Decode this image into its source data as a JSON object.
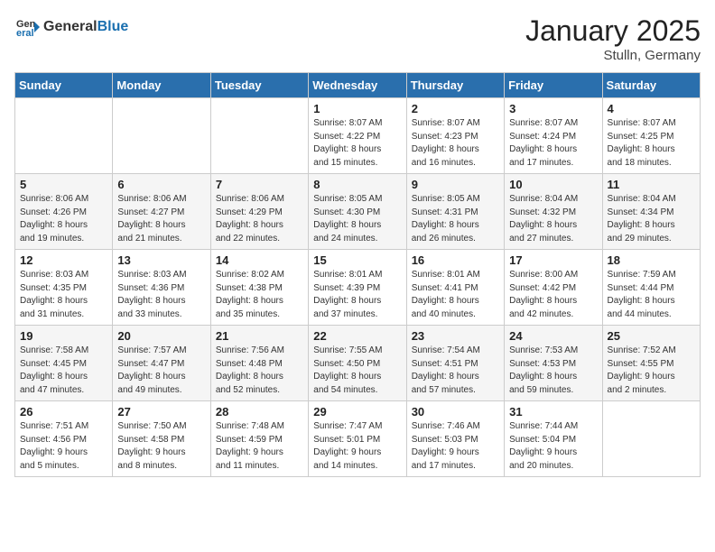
{
  "logo": {
    "general": "General",
    "blue": "Blue"
  },
  "title": "January 2025",
  "location": "Stulln, Germany",
  "days_header": [
    "Sunday",
    "Monday",
    "Tuesday",
    "Wednesday",
    "Thursday",
    "Friday",
    "Saturday"
  ],
  "weeks": [
    [
      {
        "day": "",
        "info": ""
      },
      {
        "day": "",
        "info": ""
      },
      {
        "day": "",
        "info": ""
      },
      {
        "day": "1",
        "info": "Sunrise: 8:07 AM\nSunset: 4:22 PM\nDaylight: 8 hours\nand 15 minutes."
      },
      {
        "day": "2",
        "info": "Sunrise: 8:07 AM\nSunset: 4:23 PM\nDaylight: 8 hours\nand 16 minutes."
      },
      {
        "day": "3",
        "info": "Sunrise: 8:07 AM\nSunset: 4:24 PM\nDaylight: 8 hours\nand 17 minutes."
      },
      {
        "day": "4",
        "info": "Sunrise: 8:07 AM\nSunset: 4:25 PM\nDaylight: 8 hours\nand 18 minutes."
      }
    ],
    [
      {
        "day": "5",
        "info": "Sunrise: 8:06 AM\nSunset: 4:26 PM\nDaylight: 8 hours\nand 19 minutes."
      },
      {
        "day": "6",
        "info": "Sunrise: 8:06 AM\nSunset: 4:27 PM\nDaylight: 8 hours\nand 21 minutes."
      },
      {
        "day": "7",
        "info": "Sunrise: 8:06 AM\nSunset: 4:29 PM\nDaylight: 8 hours\nand 22 minutes."
      },
      {
        "day": "8",
        "info": "Sunrise: 8:05 AM\nSunset: 4:30 PM\nDaylight: 8 hours\nand 24 minutes."
      },
      {
        "day": "9",
        "info": "Sunrise: 8:05 AM\nSunset: 4:31 PM\nDaylight: 8 hours\nand 26 minutes."
      },
      {
        "day": "10",
        "info": "Sunrise: 8:04 AM\nSunset: 4:32 PM\nDaylight: 8 hours\nand 27 minutes."
      },
      {
        "day": "11",
        "info": "Sunrise: 8:04 AM\nSunset: 4:34 PM\nDaylight: 8 hours\nand 29 minutes."
      }
    ],
    [
      {
        "day": "12",
        "info": "Sunrise: 8:03 AM\nSunset: 4:35 PM\nDaylight: 8 hours\nand 31 minutes."
      },
      {
        "day": "13",
        "info": "Sunrise: 8:03 AM\nSunset: 4:36 PM\nDaylight: 8 hours\nand 33 minutes."
      },
      {
        "day": "14",
        "info": "Sunrise: 8:02 AM\nSunset: 4:38 PM\nDaylight: 8 hours\nand 35 minutes."
      },
      {
        "day": "15",
        "info": "Sunrise: 8:01 AM\nSunset: 4:39 PM\nDaylight: 8 hours\nand 37 minutes."
      },
      {
        "day": "16",
        "info": "Sunrise: 8:01 AM\nSunset: 4:41 PM\nDaylight: 8 hours\nand 40 minutes."
      },
      {
        "day": "17",
        "info": "Sunrise: 8:00 AM\nSunset: 4:42 PM\nDaylight: 8 hours\nand 42 minutes."
      },
      {
        "day": "18",
        "info": "Sunrise: 7:59 AM\nSunset: 4:44 PM\nDaylight: 8 hours\nand 44 minutes."
      }
    ],
    [
      {
        "day": "19",
        "info": "Sunrise: 7:58 AM\nSunset: 4:45 PM\nDaylight: 8 hours\nand 47 minutes."
      },
      {
        "day": "20",
        "info": "Sunrise: 7:57 AM\nSunset: 4:47 PM\nDaylight: 8 hours\nand 49 minutes."
      },
      {
        "day": "21",
        "info": "Sunrise: 7:56 AM\nSunset: 4:48 PM\nDaylight: 8 hours\nand 52 minutes."
      },
      {
        "day": "22",
        "info": "Sunrise: 7:55 AM\nSunset: 4:50 PM\nDaylight: 8 hours\nand 54 minutes."
      },
      {
        "day": "23",
        "info": "Sunrise: 7:54 AM\nSunset: 4:51 PM\nDaylight: 8 hours\nand 57 minutes."
      },
      {
        "day": "24",
        "info": "Sunrise: 7:53 AM\nSunset: 4:53 PM\nDaylight: 8 hours\nand 59 minutes."
      },
      {
        "day": "25",
        "info": "Sunrise: 7:52 AM\nSunset: 4:55 PM\nDaylight: 9 hours\nand 2 minutes."
      }
    ],
    [
      {
        "day": "26",
        "info": "Sunrise: 7:51 AM\nSunset: 4:56 PM\nDaylight: 9 hours\nand 5 minutes."
      },
      {
        "day": "27",
        "info": "Sunrise: 7:50 AM\nSunset: 4:58 PM\nDaylight: 9 hours\nand 8 minutes."
      },
      {
        "day": "28",
        "info": "Sunrise: 7:48 AM\nSunset: 4:59 PM\nDaylight: 9 hours\nand 11 minutes."
      },
      {
        "day": "29",
        "info": "Sunrise: 7:47 AM\nSunset: 5:01 PM\nDaylight: 9 hours\nand 14 minutes."
      },
      {
        "day": "30",
        "info": "Sunrise: 7:46 AM\nSunset: 5:03 PM\nDaylight: 9 hours\nand 17 minutes."
      },
      {
        "day": "31",
        "info": "Sunrise: 7:44 AM\nSunset: 5:04 PM\nDaylight: 9 hours\nand 20 minutes."
      },
      {
        "day": "",
        "info": ""
      }
    ]
  ]
}
